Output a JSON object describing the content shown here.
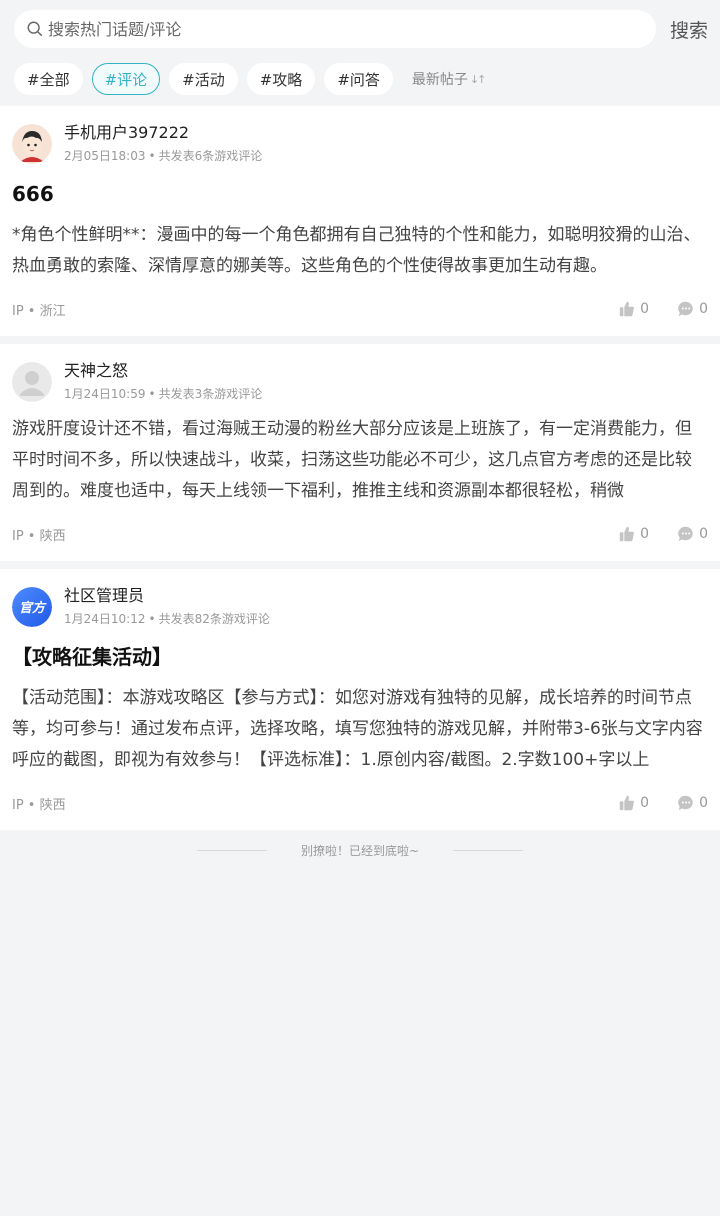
{
  "search": {
    "placeholder": "搜索热门话题/评论",
    "button": "搜索"
  },
  "tags": [
    "#全部",
    "#评论",
    "#活动",
    "#攻略",
    "#问答"
  ],
  "active_tag_index": 1,
  "sort": {
    "label": "最新帖子",
    "icon": "sort-arrows-icon"
  },
  "colors": {
    "accent": "#34b3c4",
    "official_badge": "#2f6ef5"
  },
  "posts": [
    {
      "avatar_icon": "cartoon-boy-avatar-icon",
      "user": "手机用户397222",
      "time": "2月05日18:03",
      "post_count": "共发表6条游戏评论",
      "title": "666",
      "body": "*角色个性鲜明**：漫画中的每一个角色都拥有自己独特的个性和能力，如聪明狡猾的山治、热血勇敢的索隆、深情厚意的娜美等。这些角色的个性使得故事更加生动有趣。",
      "ip": "IP • 浙江",
      "likes": "0",
      "comments": "0"
    },
    {
      "avatar_icon": "default-user-avatar-icon",
      "user": "天神之怒",
      "time": "1月24日10:59",
      "post_count": "共发表3条游戏评论",
      "title": "",
      "body": "游戏肝度设计还不错，看过海贼王动漫的粉丝大部分应该是上班族了，有一定消费能力，但平时时间不多，所以快速战斗，收菜，扫荡这些功能必不可少，这几点官方考虑的还是比较周到的。难度也适中，每天上线领一下福利，推推主线和资源副本都很轻松，稍微",
      "ip": "IP • 陕西",
      "likes": "0",
      "comments": "0"
    },
    {
      "avatar_icon": "official-badge-avatar-icon",
      "avatar_text": "官方",
      "user": "社区管理员",
      "time": "1月24日10:12",
      "post_count": "共发表82条游戏评论",
      "title": "【攻略征集活动】",
      "body": "【活动范围】：本游戏攻略区【参与方式】：如您对游戏有独特的见解，成长培养的时间节点等，均可参与！通过发布点评，选择攻略，填写您独特的游戏见解，并附带3-6张与文字内容呼应的截图，即视为有效参与！【评选标准】：1.原创内容/截图。2.字数100+字以上",
      "ip": "IP • 陕西",
      "likes": "0",
      "comments": "0"
    }
  ],
  "end_text": "别撩啦！已经到底啦~"
}
